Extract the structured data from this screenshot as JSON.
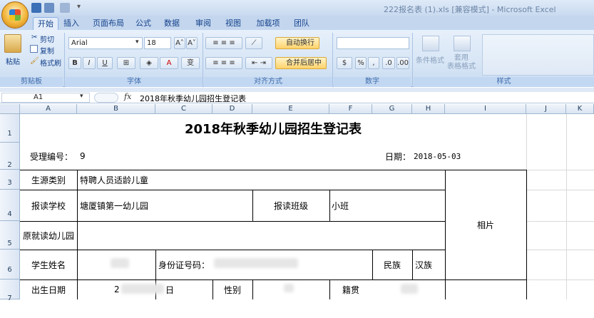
{
  "window": {
    "title": "222报名表 (1).xls  [兼容模式] - Microsoft Excel"
  },
  "tabs": [
    "开始",
    "插入",
    "页面布局",
    "公式",
    "数据",
    "审阅",
    "视图",
    "加载项",
    "团队"
  ],
  "ribbon": {
    "paste_label": "粘贴",
    "cut_label": "剪切",
    "copy_label": "复制",
    "format_painter_label": "格式刷",
    "font_name": "Arial",
    "font_size": "18",
    "bold": "B",
    "italic": "I",
    "underline": "U",
    "wrap_text_label": "自动换行",
    "merge_center_label": "合并后居中",
    "percent_label": "%",
    "comma_label": ",",
    "conditional_format_label": "条件格式",
    "table_format_label": "套用\n表格格式",
    "groups": {
      "clipboard": "剪贴板",
      "font": "字体",
      "alignment": "对齐方式",
      "number": "数字",
      "styles": "样式"
    }
  },
  "formula_bar": {
    "name_box": "A1",
    "fx": "fx",
    "content": "2018年秋季幼儿园招生登记表"
  },
  "columns": [
    "A",
    "B",
    "C",
    "D",
    "E",
    "F",
    "G",
    "H",
    "I",
    "J",
    "K"
  ],
  "rows": [
    "1",
    "2",
    "3",
    "4",
    "5",
    "6",
    "7"
  ],
  "sheet": {
    "title": "2018年秋季幼儿园招生登记表",
    "receipt_label": "受理编号：",
    "receipt_value": "9",
    "date_label": "日期：",
    "date_value": "2018-05-03",
    "source_label": "生源类别",
    "source_value": "特聘人员适龄儿童",
    "school_label": "报读学校",
    "school_value": "塘厦镇第一幼儿园",
    "class_label": "报读班级",
    "class_value": "小班",
    "prev_school_label": "原就读幼儿园",
    "photo_label": "相片",
    "name_label": "学生姓名",
    "id_label": "身份证号码：",
    "ethnicity_label": "民族",
    "ethnicity_value": "汉族",
    "birthdate_label": "出生日期",
    "birthdate_value_start": "2",
    "birthdate_value_end": "日",
    "gender_label": "性别",
    "native_place_label": "籍贯"
  }
}
